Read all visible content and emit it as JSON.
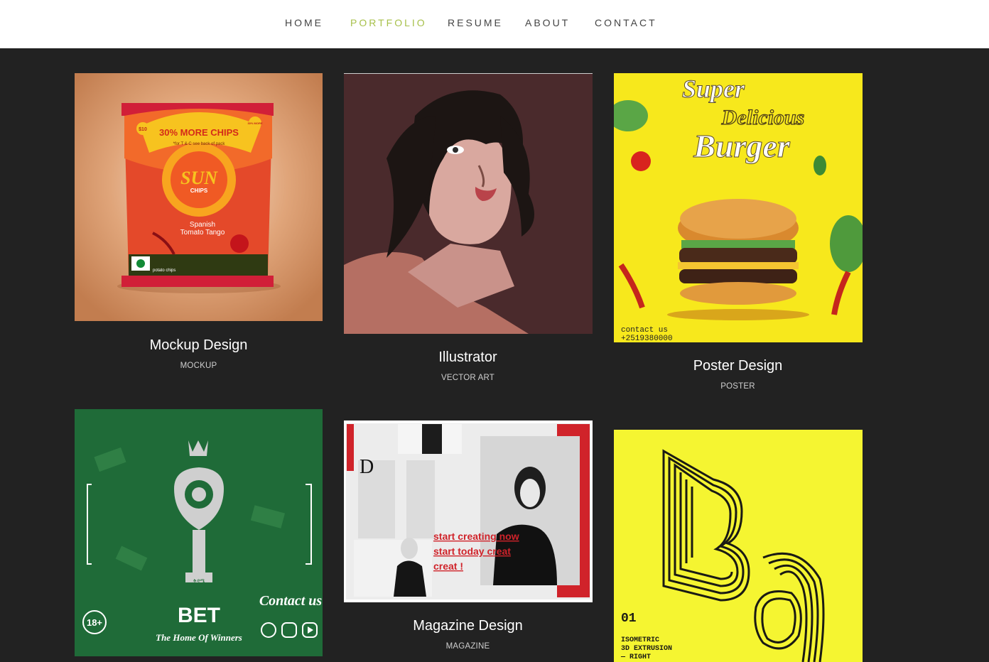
{
  "nav": {
    "items": [
      {
        "label": "HOME",
        "active": false
      },
      {
        "label": "PORTFOLIO",
        "active": true
      },
      {
        "label": "RESUME",
        "active": false
      },
      {
        "label": "ABOUT",
        "active": false
      },
      {
        "label": "CONTACT",
        "active": false
      }
    ]
  },
  "colors": {
    "page_bg": "#222222",
    "nav_bg": "#ffffff",
    "nav_text": "#444444",
    "nav_active": "#a7c04a",
    "title": "#ffffff",
    "category": "#cfcfcf"
  },
  "portfolio": [
    {
      "title": "Mockup Design",
      "category": "MOCKUP",
      "art": {
        "badge": "30% MORE CHIPS",
        "sub": "*for T & C see back of pack",
        "brand": "SUN",
        "brand2": "CHIPS",
        "flavor1": "Spanish",
        "flavor2": "Tomato Tango",
        "foot": "potato chips",
        "corner_l": "$10",
        "corner_r": "30% MORE"
      }
    },
    {
      "title": "Illustrator",
      "category": "VECTOR ART",
      "art": {}
    },
    {
      "title": "Poster Design",
      "category": "POSTER",
      "art": {
        "l1": "Super",
        "l2": "Delicious",
        "l3": "Burger",
        "c1": "contact us",
        "c2": "+2519380000"
      }
    },
    {
      "title": "",
      "category": "",
      "art": {
        "bet": "BET",
        "slogan": "The Home Of Winners",
        "age": "18+",
        "contact": "Contact us",
        "amharic": "ቅዳሜ"
      }
    },
    {
      "title": "Magazine Design",
      "category": "MAGAZINE",
      "art": {
        "dropcap": "D",
        "cta1": "start creating now",
        "cta2": "start  today  creat",
        "cta3": "creat !"
      }
    },
    {
      "title": "",
      "category": "",
      "art": {
        "big": "Ba",
        "num": "01",
        "t1": "ISOMETRIC",
        "t2": "3D EXTRUSION",
        "t3": "— RIGHT"
      }
    }
  ]
}
